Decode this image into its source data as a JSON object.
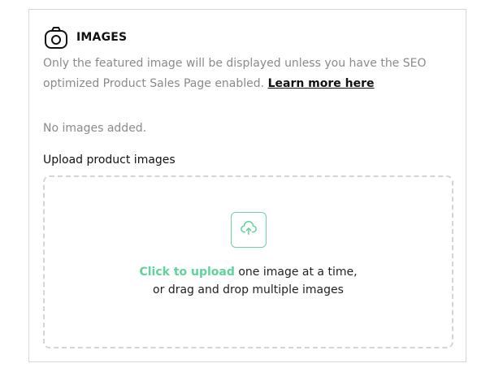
{
  "section": {
    "title": "IMAGES",
    "icon": "camera-icon",
    "description_text": "Only the featured image will be displayed unless you have the SEO optimized Product Sales Page enabled.",
    "learn_more_link": "Learn more here",
    "empty_state": "No images added.",
    "upload_label": "Upload product images"
  },
  "dropzone": {
    "icon": "cloud-upload-icon",
    "click_to_upload": "Click to upload",
    "line1_rest": "one image at a time,",
    "line2": "or drag and drop multiple images"
  },
  "colors": {
    "accent": "#5fd39c",
    "border": "#d7d7d7",
    "muted_text": "#8a8a8a"
  }
}
